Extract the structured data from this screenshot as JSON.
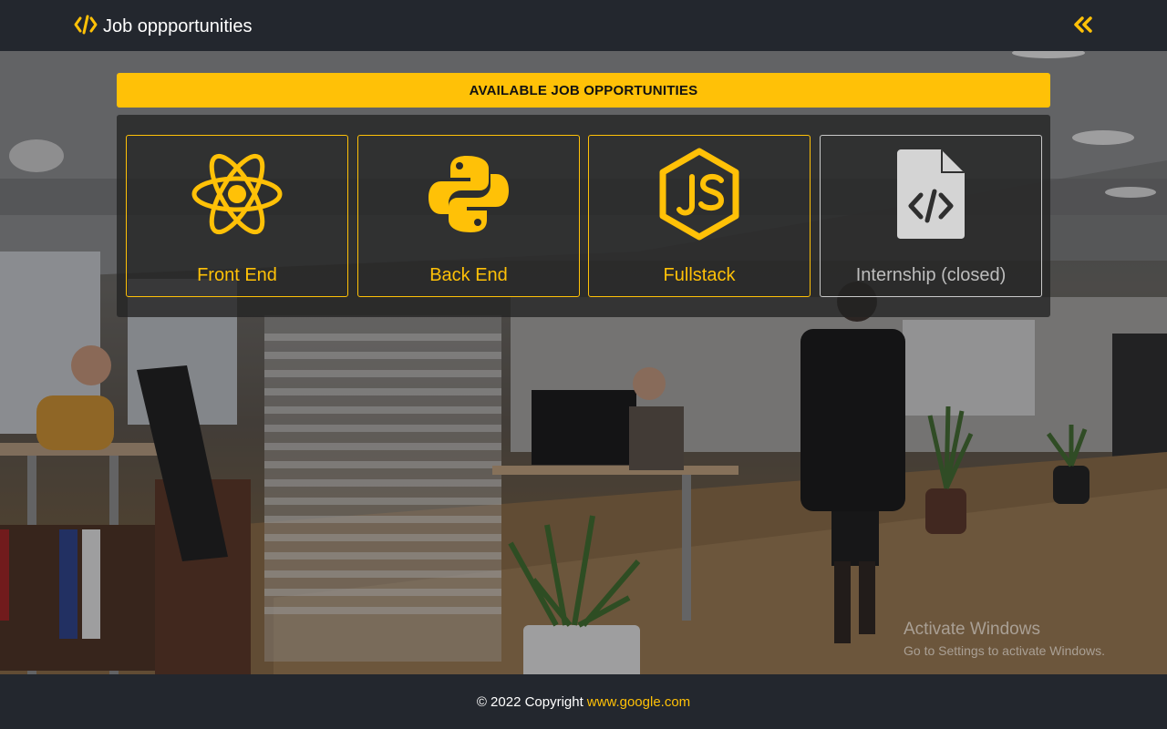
{
  "navbar": {
    "brand_icon": "code-icon",
    "title": "Job oppportunities",
    "collapse_icon": "double-chevron-left-icon"
  },
  "section": {
    "heading": "AVAILABLE JOB OPPORTUNITIES"
  },
  "cards": [
    {
      "label": "Front End",
      "icon": "react-icon",
      "status": "open"
    },
    {
      "label": "Back End",
      "icon": "python-icon",
      "status": "open"
    },
    {
      "label": "Fullstack",
      "icon": "nodejs-icon",
      "status": "open"
    },
    {
      "label": "Internship (closed)",
      "icon": "code-file-icon",
      "status": "closed"
    }
  ],
  "watermark": {
    "line1": "Activate Windows",
    "line2": "Go to Settings to activate Windows."
  },
  "footer": {
    "copyright": "© 2022 Copyright",
    "link_text": "www.google.com"
  },
  "colors": {
    "accent": "#ffc107",
    "navbar_bg": "#23272e",
    "closed_gray": "#c9c9c9"
  }
}
